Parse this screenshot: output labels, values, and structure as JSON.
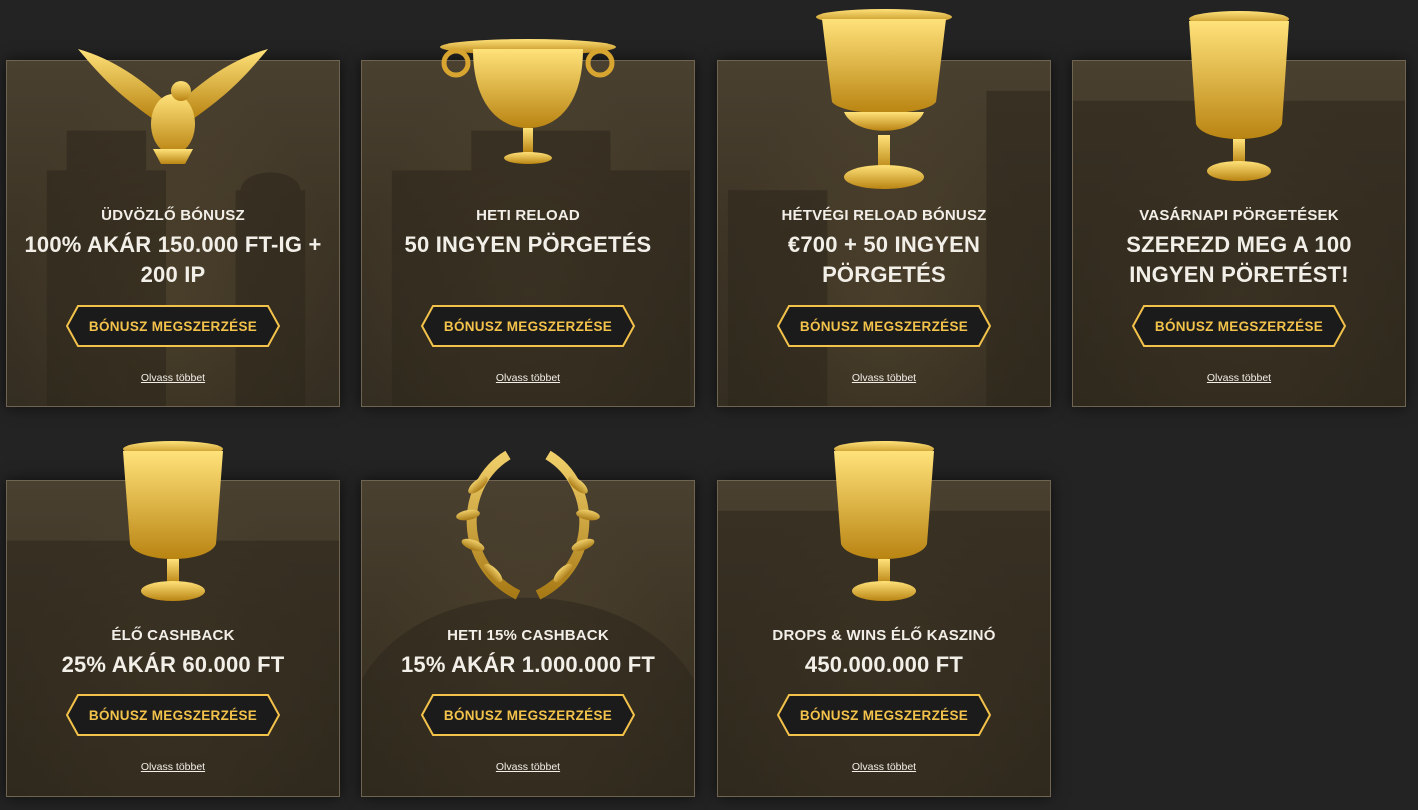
{
  "colors": {
    "background": "#232323",
    "accent": "#f3c24b",
    "button_bg": "#1b1b1b",
    "text": "#f2efe8"
  },
  "cards": [
    {
      "art": "eagle-icon",
      "subtitle": "ÜDVÖZLŐ BÓNUSZ",
      "amount": "100% AKÁR 150.000 FT-IG + 200 IP",
      "cta": "BÓNUSZ MEGSZERZÉSE",
      "more": "Olvass többet"
    },
    {
      "art": "chalice-icon",
      "subtitle": "HETI RELOAD",
      "amount": "50 INGYEN PÖRGETÉS",
      "cta": "BÓNUSZ MEGSZERZÉSE",
      "more": "Olvass többet"
    },
    {
      "art": "goblet-icon",
      "subtitle": "HÉTVÉGI RELOAD BÓNUSZ",
      "amount": "€700 + 50 INGYEN PÖRGETÉS",
      "cta": "BÓNUSZ MEGSZERZÉSE",
      "more": "Olvass többet"
    },
    {
      "art": "cup-icon",
      "subtitle": "VASÁRNAPI PÖRGETÉSEK",
      "amount": "SZEREZD MEG A 100 INGYEN PÖRETÉST!",
      "cta": "BÓNUSZ MEGSZERZÉSE",
      "more": "Olvass többet"
    },
    {
      "art": "cup-icon",
      "subtitle": "ÉLŐ CASHBACK",
      "amount": "25% AKÁR 60.000 FT",
      "cta": "BÓNUSZ MEGSZERZÉSE",
      "more": "Olvass többet"
    },
    {
      "art": "laurel-wreath-icon",
      "subtitle": "HETI 15% CASHBACK",
      "amount": "15% AKÁR 1.000.000 FT",
      "cta": "BÓNUSZ MEGSZERZÉSE",
      "more": "Olvass többet"
    },
    {
      "art": "cup-icon",
      "subtitle": "DROPS & WINS ÉLŐ KASZINÓ",
      "amount": "450.000.000 FT",
      "cta": "BÓNUSZ MEGSZERZÉSE",
      "more": "Olvass többet"
    }
  ]
}
